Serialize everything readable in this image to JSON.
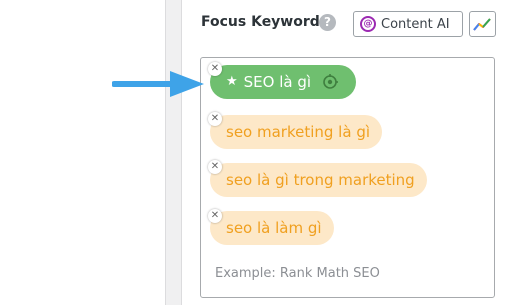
{
  "panel": {
    "title": "Focus Keyword",
    "help_glyph": "?",
    "content_ai_icon_glyph": "@",
    "content_ai_label": "Content AI",
    "trends_icon": "trending-line-icon"
  },
  "keywords": {
    "primary": {
      "label": "SEO là gì",
      "star_icon": "star-icon",
      "pillar_icon": "pillar-content-icon"
    },
    "secondary": [
      {
        "label": "seo marketing là gì"
      },
      {
        "label": "seo là gì trong marketing"
      },
      {
        "label": "seo là làm gì"
      }
    ],
    "remove_glyph": "✕",
    "placeholder": "Example: Rank Math SEO"
  },
  "colors": {
    "primary_tag": "#6fbf6f",
    "secondary_tag_bg": "#fde8c8",
    "secondary_tag_text": "#f0a020",
    "arrow": "#3ea3e8"
  }
}
